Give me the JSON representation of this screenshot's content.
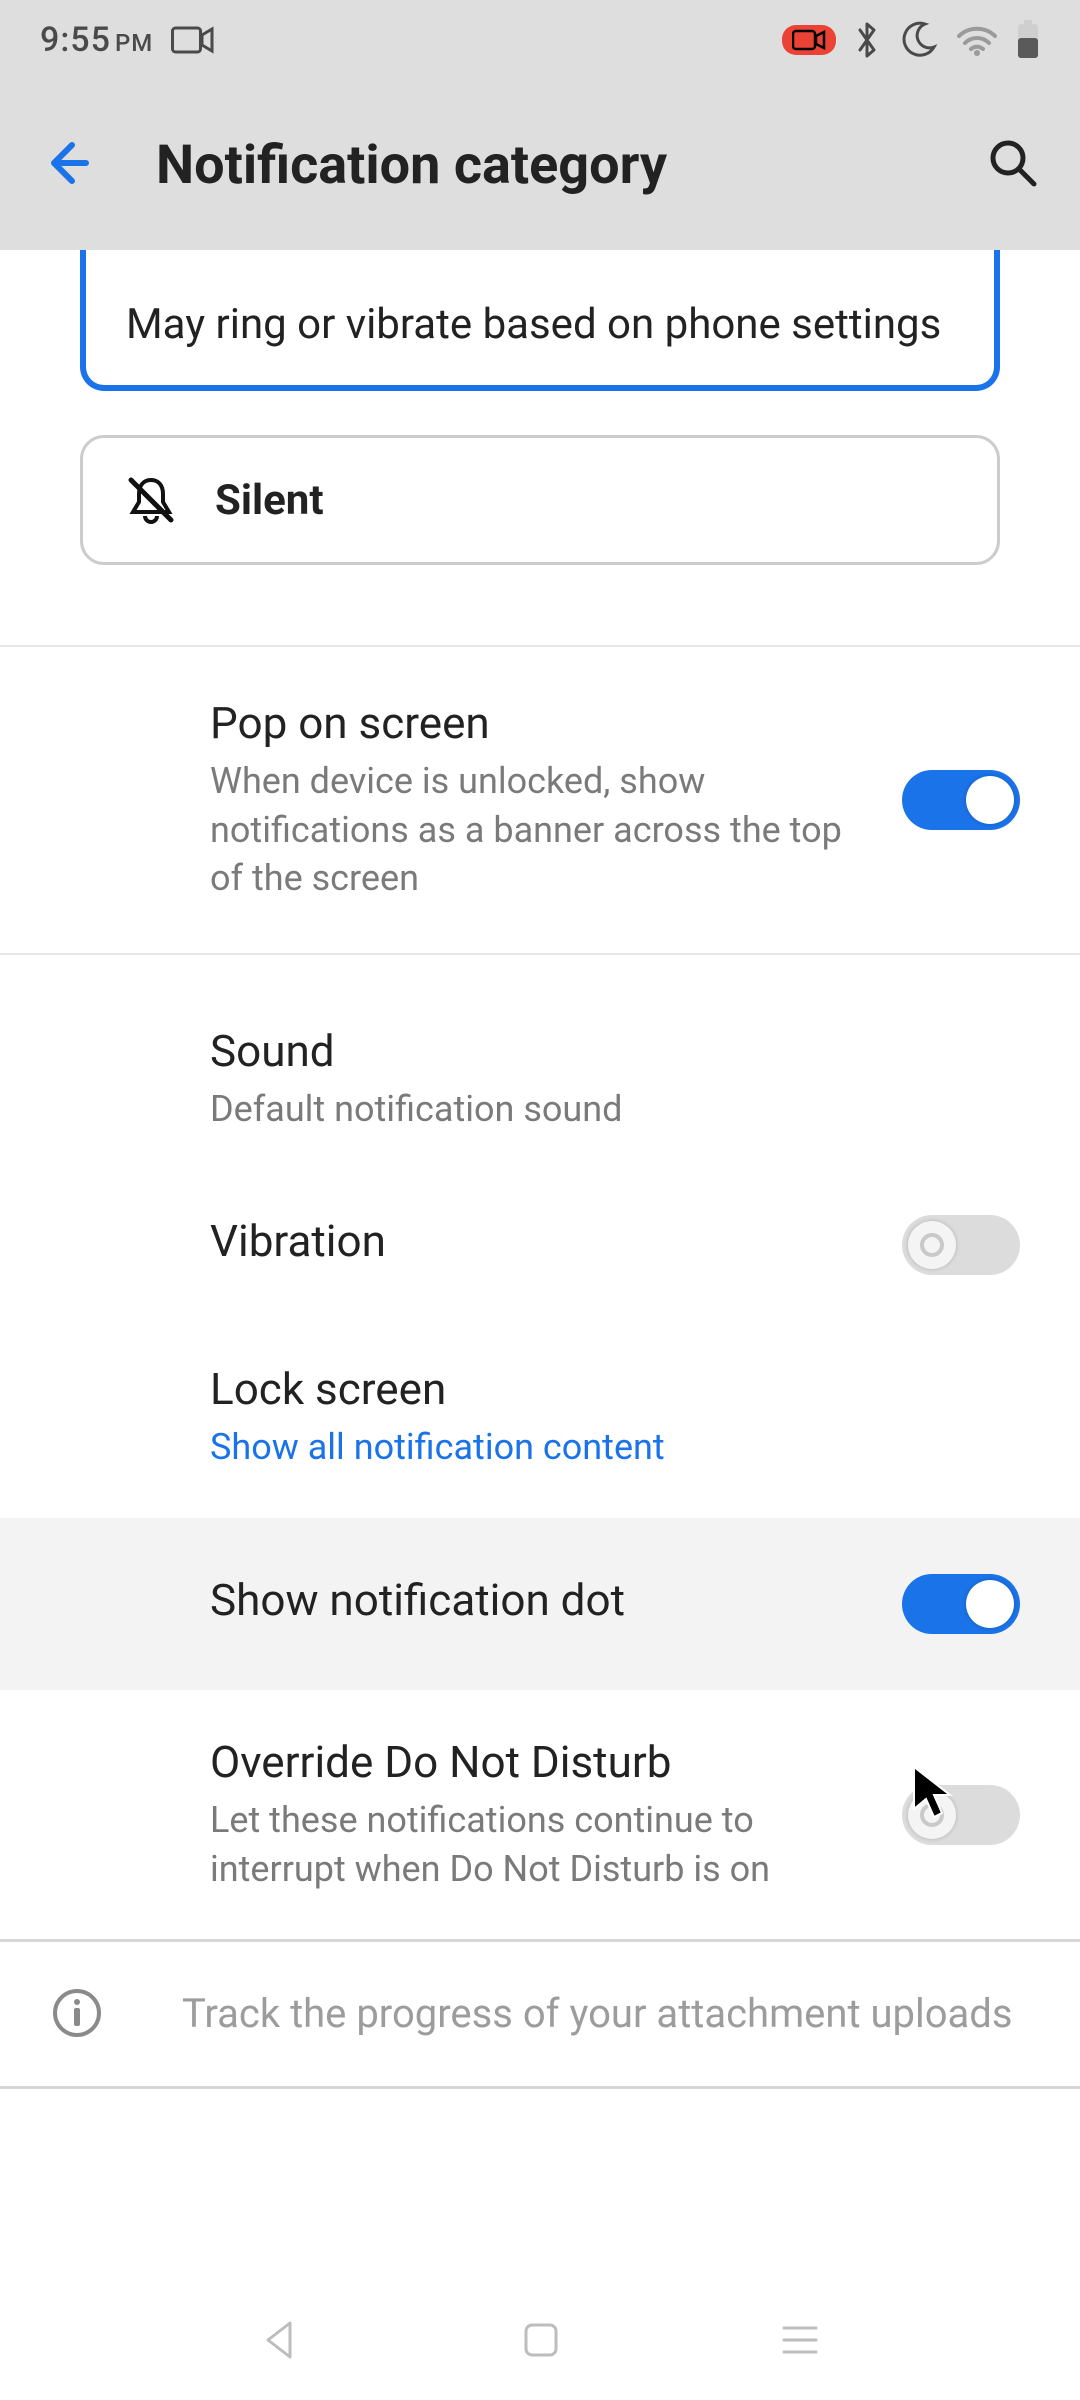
{
  "status": {
    "time": "9:55",
    "ampm": "PM"
  },
  "header": {
    "title": "Notification category"
  },
  "options": {
    "default": {
      "description": "May ring or vibrate based on phone settings"
    },
    "silent": {
      "label": "Silent"
    }
  },
  "settings": {
    "pop": {
      "title": "Pop on screen",
      "sub": "When device is unlocked, show notifications as a banner across the top of the screen",
      "on": true
    },
    "sound": {
      "title": "Sound",
      "sub": "Default notification sound"
    },
    "vibration": {
      "title": "Vibration",
      "on": false
    },
    "lockscreen": {
      "title": "Lock screen",
      "sub": "Show all notification content"
    },
    "dot": {
      "title": "Show notification dot",
      "on": true
    },
    "override": {
      "title": "Override Do Not Disturb",
      "sub": "Let these notifications continue to interrupt when Do Not Disturb is on",
      "on": false
    }
  },
  "footer": {
    "info": "Track the progress of your attachment uploads"
  }
}
